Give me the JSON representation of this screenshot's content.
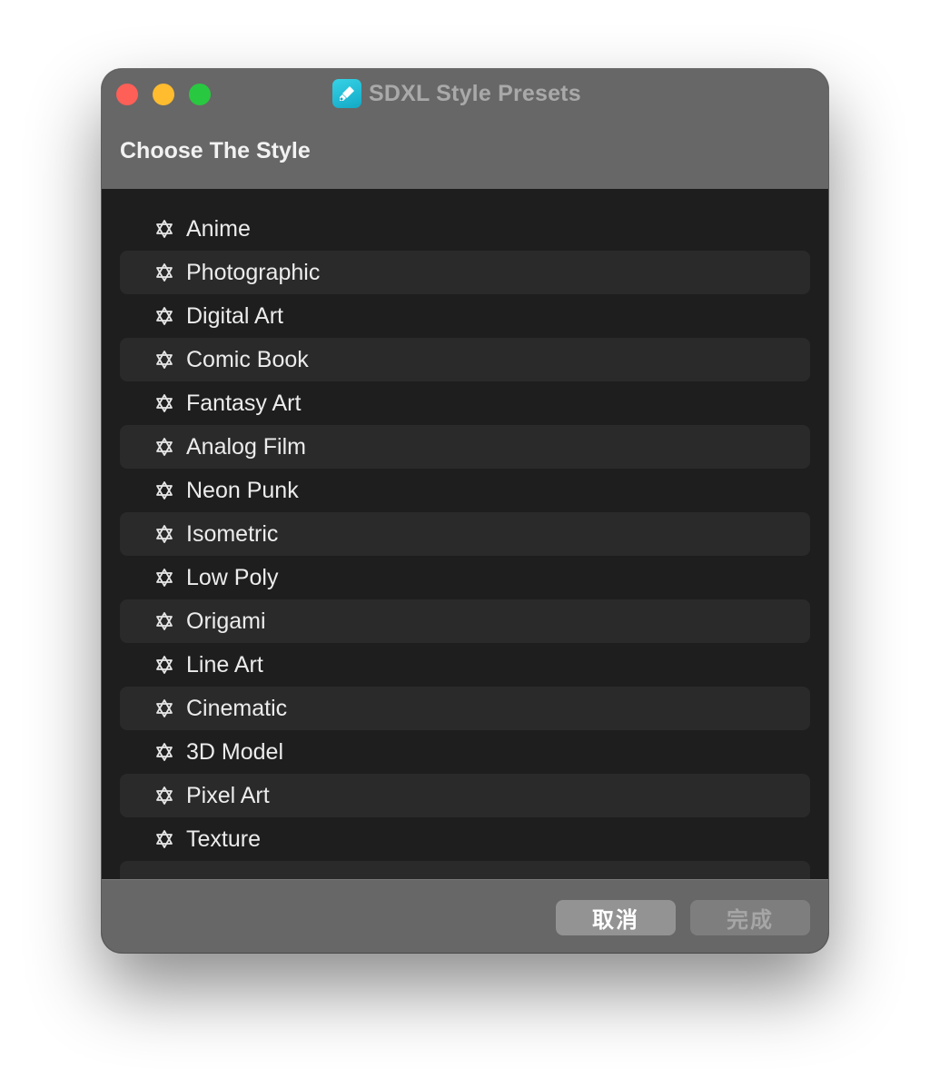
{
  "window": {
    "title": "SDXL Style Presets",
    "app_icon": "app-brush-icon"
  },
  "header": {
    "title": "Choose The Style"
  },
  "styles": {
    "icon": "star-of-david-icon",
    "items": [
      {
        "label": "Anime"
      },
      {
        "label": "Photographic"
      },
      {
        "label": "Digital Art"
      },
      {
        "label": "Comic Book"
      },
      {
        "label": "Fantasy Art"
      },
      {
        "label": "Analog Film"
      },
      {
        "label": "Neon Punk"
      },
      {
        "label": "Isometric"
      },
      {
        "label": "Low Poly"
      },
      {
        "label": "Origami"
      },
      {
        "label": "Line Art"
      },
      {
        "label": "Cinematic"
      },
      {
        "label": "3D Model"
      },
      {
        "label": "Pixel Art"
      },
      {
        "label": "Texture"
      }
    ]
  },
  "footer": {
    "cancel_label": "取消",
    "done_label": "完成"
  },
  "colors": {
    "titlebar": "#676767",
    "list_bg": "#1e1e1e",
    "row_alt": "#2a2a2a",
    "app_icon": "#22bfd8",
    "close": "#fe5f57",
    "minimize": "#febc2e",
    "zoom": "#28c840"
  }
}
